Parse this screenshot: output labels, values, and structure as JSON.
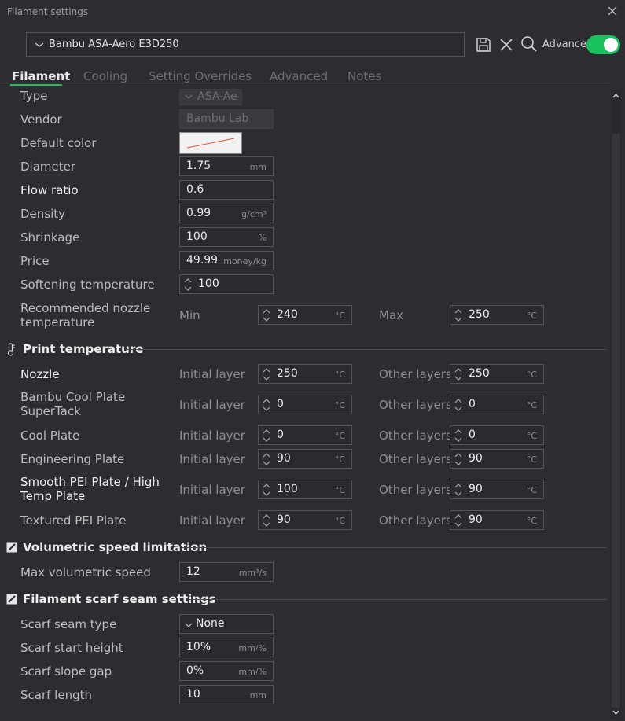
{
  "window": {
    "title": "Filament settings"
  },
  "preset": {
    "name": "Bambu ASA-Aero E3D250"
  },
  "toolbar": {
    "advanced_label": "Advanced"
  },
  "tabs": [
    "Filament",
    "Cooling",
    "Setting Overrides",
    "Advanced",
    "Notes"
  ],
  "basic": {
    "type": {
      "label": "Type",
      "value": "ASA-Ae"
    },
    "vendor": {
      "label": "Vendor",
      "value": "Bambu Lab"
    },
    "default_color": {
      "label": "Default color"
    },
    "diameter": {
      "label": "Diameter",
      "value": "1.75",
      "unit": "mm"
    },
    "flow_ratio": {
      "label": "Flow ratio",
      "value": "0.6"
    },
    "density": {
      "label": "Density",
      "value": "0.99",
      "unit": "g/cm³"
    },
    "shrinkage": {
      "label": "Shrinkage",
      "value": "100",
      "unit": "%"
    },
    "price": {
      "label": "Price",
      "value": "49.99",
      "unit": "money/kg"
    },
    "softening": {
      "label": "Softening temperature",
      "value": "100"
    },
    "rec_nozzle": {
      "label1": "Recommended nozzle",
      "label2": "temperature",
      "min_label": "Min",
      "min_value": "240",
      "max_label": "Max",
      "max_value": "250",
      "unit": "°C"
    }
  },
  "print_temp": {
    "title": "Print temperature",
    "initial_label": "Initial layer",
    "other_label": "Other layers",
    "unit": "°C",
    "rows": [
      {
        "label1": "Nozzle",
        "label2": "",
        "initial": "250",
        "other": "250"
      },
      {
        "label1": "Bambu Cool Plate",
        "label2": "SuperTack",
        "initial": "0",
        "other": "0"
      },
      {
        "label1": "Cool Plate",
        "label2": "",
        "initial": "0",
        "other": "0"
      },
      {
        "label1": "Engineering Plate",
        "label2": "",
        "initial": "90",
        "other": "90"
      },
      {
        "label1": "Smooth PEI Plate / High",
        "label2": "Temp Plate",
        "initial": "100",
        "other": "90"
      },
      {
        "label1": "Textured PEI Plate",
        "label2": "",
        "initial": "90",
        "other": "90"
      }
    ]
  },
  "volumetric": {
    "title": "Volumetric speed limitation",
    "max_speed": {
      "label": "Max volumetric speed",
      "value": "12",
      "unit": "mm³/s"
    }
  },
  "scarf": {
    "title": "Filament scarf seam settings",
    "type": {
      "label": "Scarf seam type",
      "value": "None"
    },
    "start_height": {
      "label": "Scarf start height",
      "value": "10%",
      "unit": "mm/%"
    },
    "slope_gap": {
      "label": "Scarf slope gap",
      "value": "0%",
      "unit": "mm/%"
    },
    "length": {
      "label": "Scarf length",
      "value": "10",
      "unit": "mm"
    }
  },
  "colors": {
    "accent": "#19c05e",
    "background": "#2d2d31",
    "swatch_line": "#e8532e"
  }
}
